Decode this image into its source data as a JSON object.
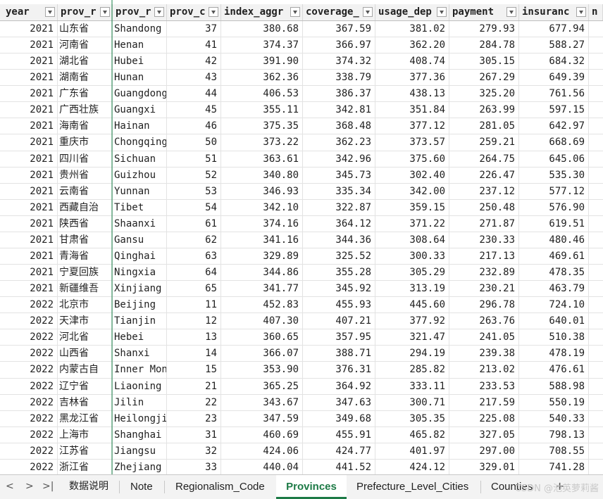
{
  "columns": [
    {
      "label": "year"
    },
    {
      "label": "prov_r"
    },
    {
      "label": "prov_r"
    },
    {
      "label": "prov_c"
    },
    {
      "label": "index_aggr"
    },
    {
      "label": "coverage_"
    },
    {
      "label": "usage_dep"
    },
    {
      "label": "payment"
    },
    {
      "label": "insuranc"
    },
    {
      "label": "n"
    }
  ],
  "rows": [
    [
      "2021",
      "山东省",
      "Shandong",
      "37",
      "380.68",
      "367.59",
      "381.02",
      "279.93",
      "677.94"
    ],
    [
      "2021",
      "河南省",
      "Henan",
      "41",
      "374.37",
      "366.97",
      "362.20",
      "284.78",
      "588.27"
    ],
    [
      "2021",
      "湖北省",
      "Hubei",
      "42",
      "391.90",
      "374.32",
      "408.74",
      "305.15",
      "684.32"
    ],
    [
      "2021",
      "湖南省",
      "Hunan",
      "43",
      "362.36",
      "338.79",
      "377.36",
      "267.29",
      "649.39"
    ],
    [
      "2021",
      "广东省",
      "Guangdong",
      "44",
      "406.53",
      "386.37",
      "438.13",
      "325.20",
      "761.56"
    ],
    [
      "2021",
      "广西壮族",
      "Guangxi",
      "45",
      "355.11",
      "342.81",
      "351.84",
      "263.99",
      "597.15"
    ],
    [
      "2021",
      "海南省",
      "Hainan",
      "46",
      "375.35",
      "368.48",
      "377.12",
      "281.05",
      "642.97"
    ],
    [
      "2021",
      "重庆市",
      "Chongqing",
      "50",
      "373.22",
      "362.23",
      "373.57",
      "259.21",
      "668.69"
    ],
    [
      "2021",
      "四川省",
      "Sichuan",
      "51",
      "363.61",
      "342.96",
      "375.60",
      "264.75",
      "645.06"
    ],
    [
      "2021",
      "贵州省",
      "Guizhou",
      "52",
      "340.80",
      "345.73",
      "302.40",
      "226.47",
      "535.30"
    ],
    [
      "2021",
      "云南省",
      "Yunnan",
      "53",
      "346.93",
      "335.34",
      "342.00",
      "237.12",
      "577.12"
    ],
    [
      "2021",
      "西藏自治",
      "Tibet",
      "54",
      "342.10",
      "322.87",
      "359.15",
      "250.48",
      "576.90"
    ],
    [
      "2021",
      "陕西省",
      "Shaanxi",
      "61",
      "374.16",
      "364.12",
      "371.22",
      "271.87",
      "619.51"
    ],
    [
      "2021",
      "甘肃省",
      "Gansu",
      "62",
      "341.16",
      "344.36",
      "308.64",
      "230.33",
      "480.46"
    ],
    [
      "2021",
      "青海省",
      "Qinghai",
      "63",
      "329.89",
      "325.52",
      "300.33",
      "217.13",
      "469.61"
    ],
    [
      "2021",
      "宁夏回族",
      "Ningxia",
      "64",
      "344.86",
      "355.28",
      "305.29",
      "232.89",
      "478.35"
    ],
    [
      "2021",
      "新疆维吾",
      "Xinjiang",
      "65",
      "341.77",
      "345.92",
      "313.19",
      "230.21",
      "463.79"
    ],
    [
      "2022",
      "北京市",
      "Beijing",
      "11",
      "452.83",
      "455.93",
      "445.60",
      "296.78",
      "724.10"
    ],
    [
      "2022",
      "天津市",
      "Tianjin",
      "12",
      "407.30",
      "407.21",
      "377.92",
      "263.76",
      "640.01"
    ],
    [
      "2022",
      "河北省",
      "Hebei",
      "13",
      "360.65",
      "357.95",
      "321.47",
      "241.05",
      "510.38"
    ],
    [
      "2022",
      "山西省",
      "Shanxi",
      "14",
      "366.07",
      "388.71",
      "294.19",
      "239.38",
      "478.19"
    ],
    [
      "2022",
      "内蒙古自",
      "Inner Mon",
      "15",
      "353.90",
      "376.31",
      "285.82",
      "213.02",
      "476.61"
    ],
    [
      "2022",
      "辽宁省",
      "Liaoning",
      "21",
      "365.25",
      "364.92",
      "333.11",
      "233.53",
      "588.98"
    ],
    [
      "2022",
      "吉林省",
      "Jilin",
      "22",
      "343.67",
      "347.63",
      "300.71",
      "217.59",
      "550.19"
    ],
    [
      "2022",
      "黑龙江省",
      "Heilongji",
      "23",
      "347.59",
      "349.68",
      "305.35",
      "225.08",
      "540.33"
    ],
    [
      "2022",
      "上海市",
      "Shanghai",
      "31",
      "460.69",
      "455.91",
      "465.82",
      "327.05",
      "798.13"
    ],
    [
      "2022",
      "江苏省",
      "Jiangsu",
      "32",
      "424.06",
      "424.77",
      "401.97",
      "297.00",
      "708.55"
    ],
    [
      "2022",
      "浙江省",
      "Zhejiang",
      "33",
      "440.04",
      "441.52",
      "424.12",
      "329.01",
      "741.28"
    ]
  ],
  "tabs": {
    "nav_prev": "<",
    "nav_next": ">",
    "nav_last": ">|",
    "items": [
      "数据说明",
      "Note",
      "Regionalism_Code",
      "Provinces",
      "Prefecture_Level_Cities",
      "Counties"
    ],
    "active": "Provinces",
    "add": "+"
  },
  "watermark": "CSDN @池英萝莉酱"
}
